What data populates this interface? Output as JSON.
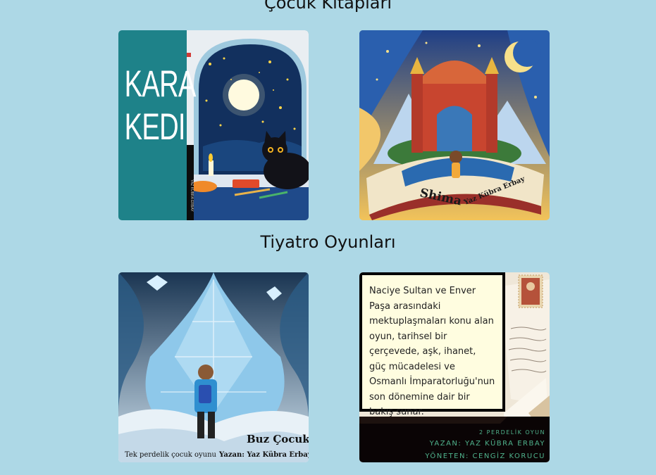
{
  "sections": [
    {
      "title": "Çocuk Kitapları"
    },
    {
      "title": "Tiyatro Oyunları"
    }
  ],
  "books": [
    {
      "cover_title_line1": "KARA",
      "cover_title_line2": "KEDI",
      "spine_text": "YAZ KÜBRA ERBAY",
      "accent": "#1e8289"
    },
    {
      "cover_title": "Shima",
      "cover_author": "Yaz Kübra Erbay"
    }
  ],
  "plays": [
    {
      "cover_title": "Buz Çocuk",
      "cover_subtitle": "Tek perdelik çocuk oyunu",
      "cover_author": "Yazan:  Yaz Kübra Erbay"
    },
    {
      "description": "Naciye Sultan ve Enver Paşa arasındaki mektuplaşmaları konu alan oyun, tarihsel bir çerçevede, aşk, ihanet, güç mücadelesi ve Osmanlı İmparatorluğu'nun son dönemine dair bir bakış sunar.",
      "meta_type": "2 PERDELİK OYUN",
      "meta_author": "YAZAN: YAZ KÜBRA ERBAY",
      "meta_director": "YÖNETEN: CENGİZ KORUCU",
      "meta_color": "#4fb28c"
    }
  ]
}
